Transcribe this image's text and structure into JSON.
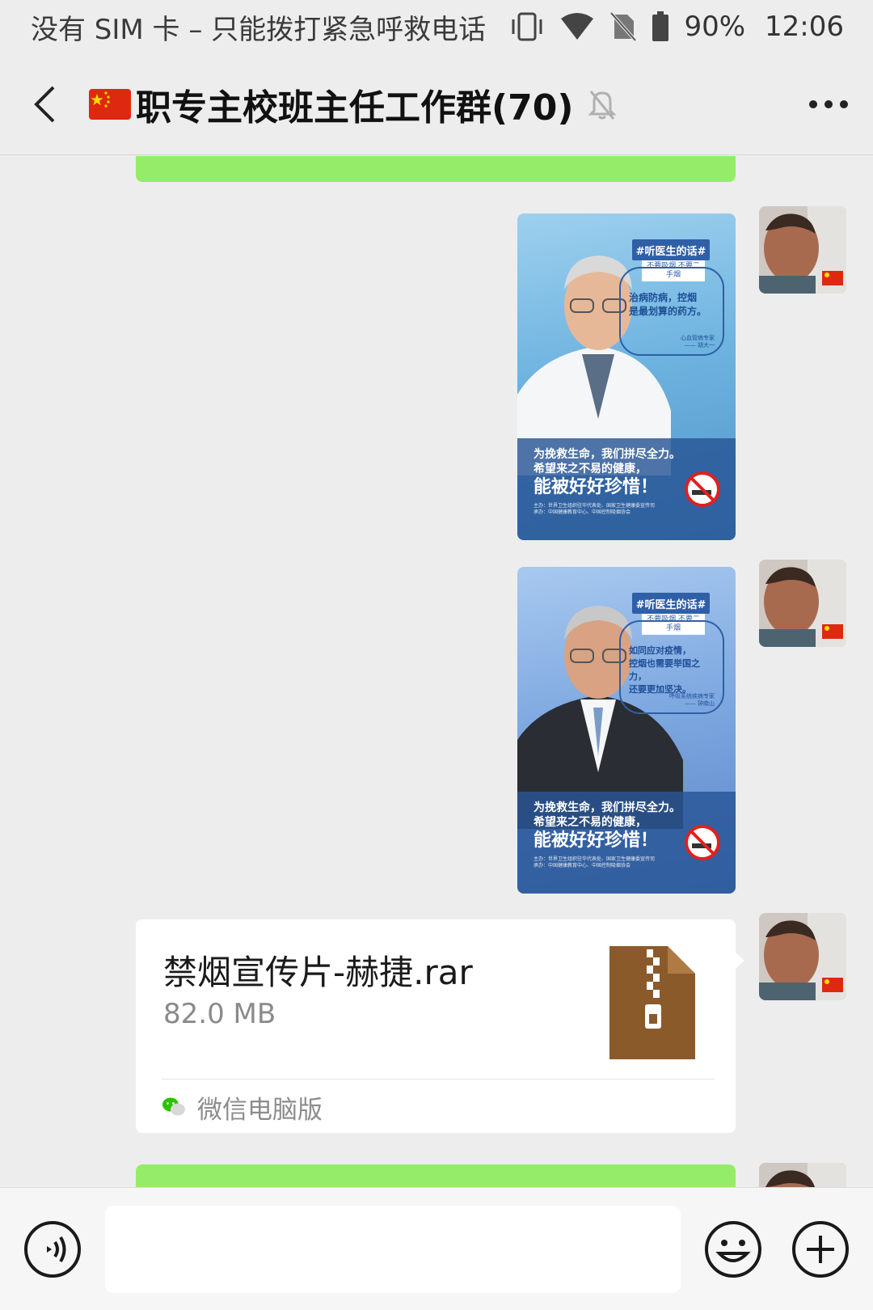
{
  "status_bar": {
    "carrier": "没有 SIM 卡 – 只能拨打紧急呼救电话",
    "battery_percent": "90%",
    "time": "12:06"
  },
  "nav": {
    "title": "职专主校班主任工作群(70)",
    "flag_icon": "china-flag",
    "muted": true
  },
  "messages": {
    "poster_1": {
      "hashtag": "#听医生的话#",
      "sub": "不要吸烟\n不要二手烟",
      "quote": "治病防病，控烟\n是最划算的药方。",
      "credit": "心血管病专家\n—— 胡大一",
      "line1": "为挽救生命，我们拼尽全力。",
      "line2": "希望来之不易的健康，",
      "line3": "能被好好珍惜！",
      "fine": "主办：世界卫生组织驻华代表处、国家卫生健康委宣传司\n承办：中国健康教育中心、中国控制吸烟协会"
    },
    "poster_2": {
      "hashtag": "#听医生的话#",
      "sub": "不要吸烟\n不要二手烟",
      "quote": "如同应对疫情，\n控烟也需要举国之力，\n还要更加坚决。",
      "credit": "呼吸系统疾病专家\n—— 钟南山",
      "line1": "为挽救生命，我们拼尽全力。",
      "line2": "希望来之不易的健康，",
      "line3": "能被好好珍惜！",
      "fine": "主办：世界卫生组织驻华代表处、国家卫生健康委宣传司\n承办：中国健康教育中心、中国控制吸烟协会"
    },
    "file": {
      "name": "禁烟宣传片-赫捷.rar",
      "size": "82.0 MB",
      "source": "微信电脑版",
      "icon": "zip-archive-icon"
    }
  },
  "input_bar": {
    "placeholder": ""
  },
  "colors": {
    "background": "#ededed",
    "my_bubble": "#95ec69",
    "file_icon": "#8b5a2b"
  }
}
